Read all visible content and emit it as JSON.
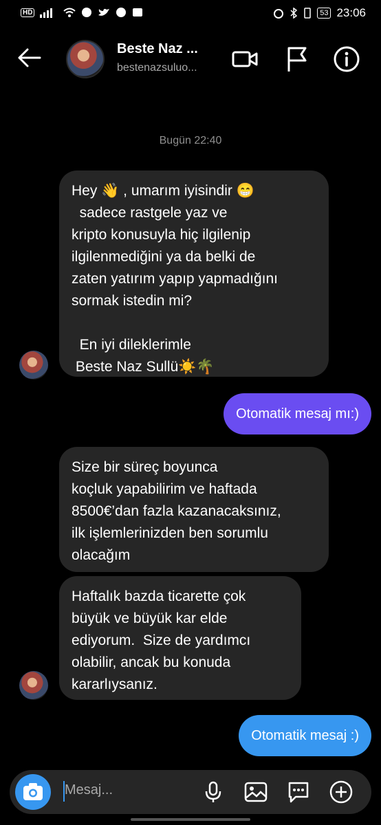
{
  "status_bar": {
    "time": "23:06",
    "battery": "53",
    "network": "HD"
  },
  "header": {
    "name": "Beste Naz ...",
    "username": "bestenazsuluo..."
  },
  "date_label": "Bugün 22:40",
  "messages": [
    {
      "dir": "in",
      "text": "Hey 👋 , umarım iyisindir 😁\n  sadece rastgele yaz ve\nkripto konusuyla hiç ilgilenip\nilgilenmediğini ya da belki de\nzaten yatırım yapıp yapmadığını\nsormak istedin mi?\n\n  En iyi dileklerimle\n Beste Naz Sullü☀️🌴"
    },
    {
      "dir": "out",
      "text": "Otomatik mesaj mı:)"
    },
    {
      "dir": "in",
      "text": "Size bir süreç boyunca\nkoçluk yapabilirim ve haftada\n8500€’dan fazla kazanacaksınız,\nilk işlemlerinizden ben sorumlu\nolacağım"
    },
    {
      "dir": "in",
      "text": "Haftalık bazda ticarette çok\nbüyük ve büyük kar elde\nediyorum.  Size de yardımcı\nolabilir, ancak bu konuda\nkararlıysanız."
    },
    {
      "dir": "out",
      "text": "Otomatik mesaj :)"
    }
  ],
  "composer": {
    "placeholder": "Mesaj..."
  },
  "colors": {
    "out_bubble_1": "#6a4df1",
    "out_bubble_2": "#3797f0",
    "in_bubble": "#262626",
    "accent": "#3797f0"
  },
  "icons": [
    "back-arrow-icon",
    "video-call-icon",
    "flag-icon",
    "info-icon",
    "camera-icon",
    "microphone-icon",
    "gallery-icon",
    "sticker-icon",
    "add-icon"
  ]
}
